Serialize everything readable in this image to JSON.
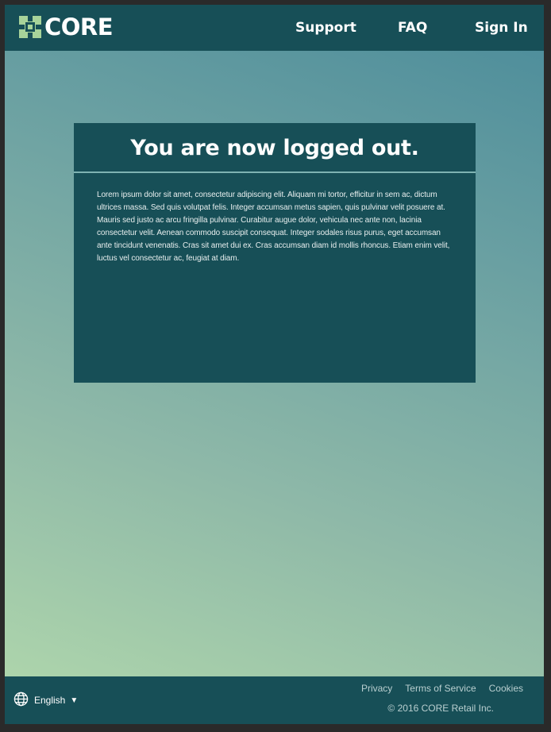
{
  "brand": {
    "name": "CORE",
    "logo_icon": "core-logo-icon",
    "accent_color": "#a7d39a",
    "bar_color": "#174f57"
  },
  "nav": {
    "support": "Support",
    "faq": "FAQ",
    "sign_in": "Sign In"
  },
  "card": {
    "title": "You are now logged out.",
    "body": "Lorem ipsum dolor sit amet, consectetur adipiscing elit. Aliquam mi tortor, efficitur in sem ac, dictum ultrices massa. Sed quis volutpat felis. Integer accumsan metus sapien, quis pulvinar velit posuere at. Mauris sed justo ac arcu fringilla pulvinar. Curabitur augue dolor, vehicula nec ante non, lacinia consectetur velit. Aenean commodo suscipit consequat. Integer sodales risus purus, eget accumsan ante tincidunt venenatis. Cras sit amet dui ex. Cras accumsan diam id mollis rhoncus. Etiam enim velit, luctus vel consectetur ac, feugiat at diam."
  },
  "footer": {
    "language": "English",
    "language_icon": "globe-icon",
    "links": {
      "privacy": "Privacy",
      "terms": "Terms of Service",
      "cookies": "Cookies"
    },
    "copyright": "© 2016 CORE Retail Inc."
  }
}
